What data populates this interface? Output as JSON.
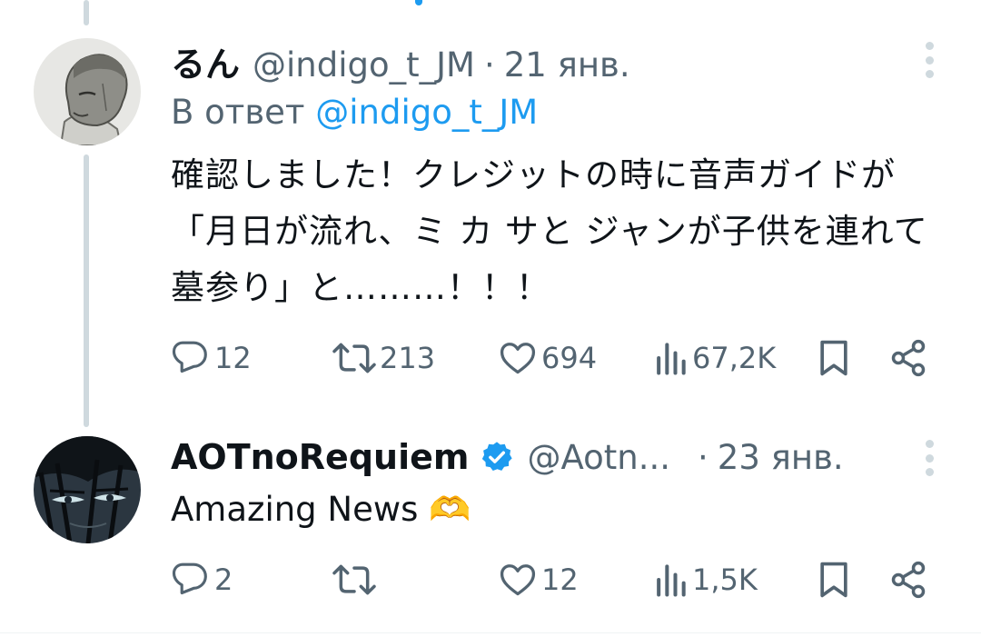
{
  "tweets": [
    {
      "name": "るん",
      "handle": "@indigo_t_JM",
      "separator": "·",
      "date": "21 янв.",
      "reply_prefix": "В ответ",
      "reply_to": "@indigo_t_JM",
      "text": "確認しました！クレジットの時に音声ガイドが「月日が流れ、ミ カ サと ジャンが子供を連れて墓参り」と………！！！",
      "replies": "12",
      "retweets": "213",
      "likes": "694",
      "views": "67,2K"
    },
    {
      "name": "AOTnoRequiem",
      "verified": true,
      "handle": "@Aotn...",
      "separator": "·",
      "date": "23 янв.",
      "text": "Amazing News 🫶",
      "replies": "2",
      "retweets": "",
      "likes": "12",
      "views": "1,5K"
    }
  ],
  "icons": {
    "reply": "reply-icon",
    "retweet": "retweet-icon",
    "like": "heart-icon",
    "views": "views-icon",
    "bookmark": "bookmark-icon",
    "share": "share-icon",
    "more": "more-vertical-icon",
    "verified": "verified-badge-icon"
  },
  "colors": {
    "text": "#0f1419",
    "secondary": "#536471",
    "accent": "#1d9bf0",
    "thread_line": "#cfd9de"
  }
}
